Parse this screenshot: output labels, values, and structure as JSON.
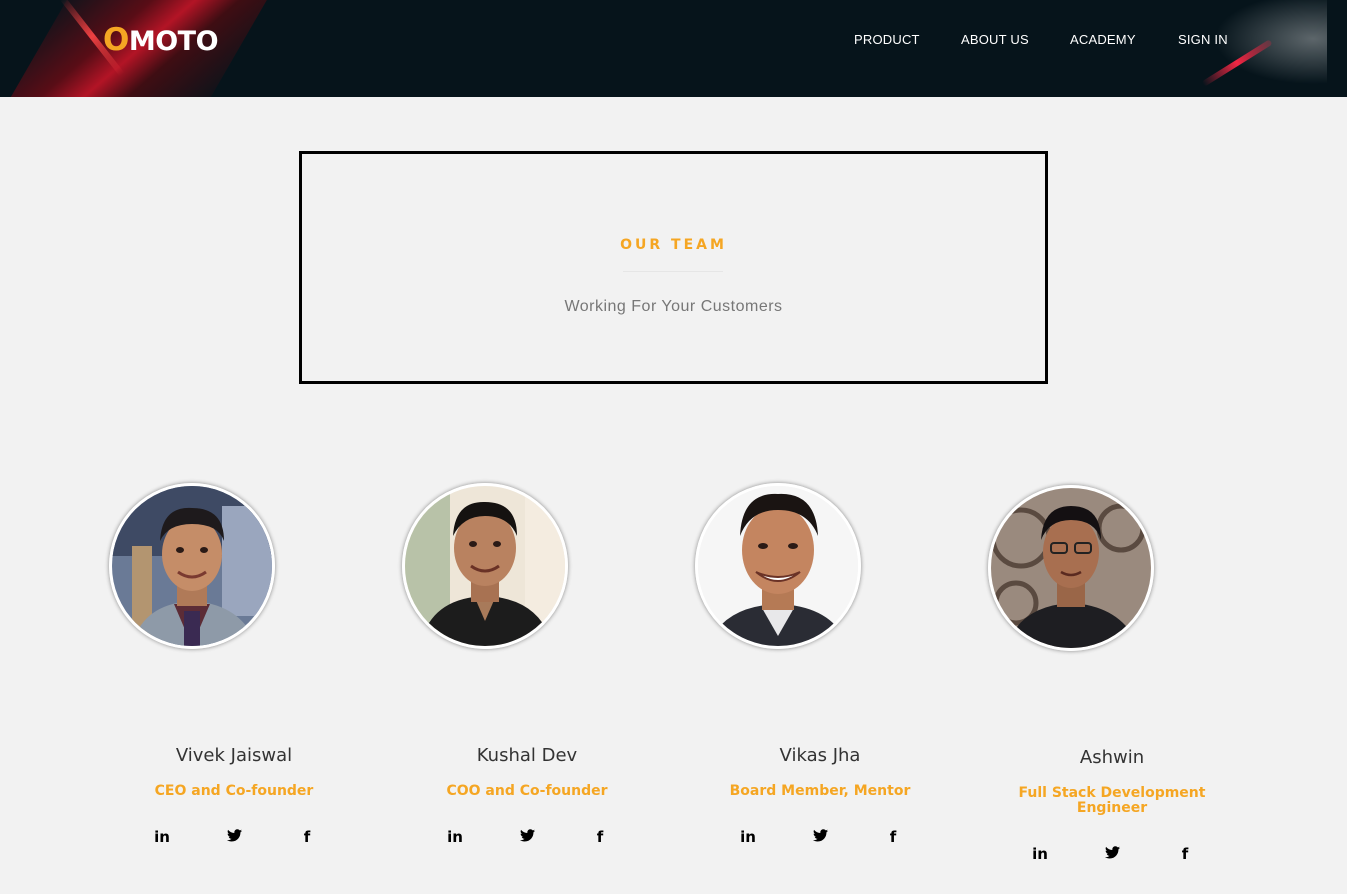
{
  "header": {
    "logo_first": "O",
    "logo_rest": "MOTO",
    "nav": [
      "PRODUCT",
      "ABOUT US",
      "ACADEMY",
      "SIGN IN"
    ]
  },
  "intro": {
    "eyebrow": "OUR TEAM",
    "subtitle": "Working For Your Customers"
  },
  "team": [
    {
      "name": "Vivek Jaiswal",
      "role": "CEO and Co-founder",
      "social": [
        "in",
        "t",
        "f"
      ]
    },
    {
      "name": "Kushal Dev",
      "role": "COO and Co-founder",
      "social": [
        "in",
        "t",
        "f"
      ]
    },
    {
      "name": "Vikas Jha",
      "role": "Board Member, Mentor",
      "social": [
        "in",
        "t",
        "f"
      ]
    },
    {
      "name": "Ashwin",
      "role": "Full Stack Development Engineer",
      "social": [
        "in",
        "t",
        "f"
      ]
    }
  ],
  "colors": {
    "accent": "#f5a623",
    "header_bg": "#06141b",
    "page_bg": "#f2f2f2"
  },
  "icons": [
    "linkedin-icon",
    "twitter-icon",
    "facebook-icon"
  ]
}
